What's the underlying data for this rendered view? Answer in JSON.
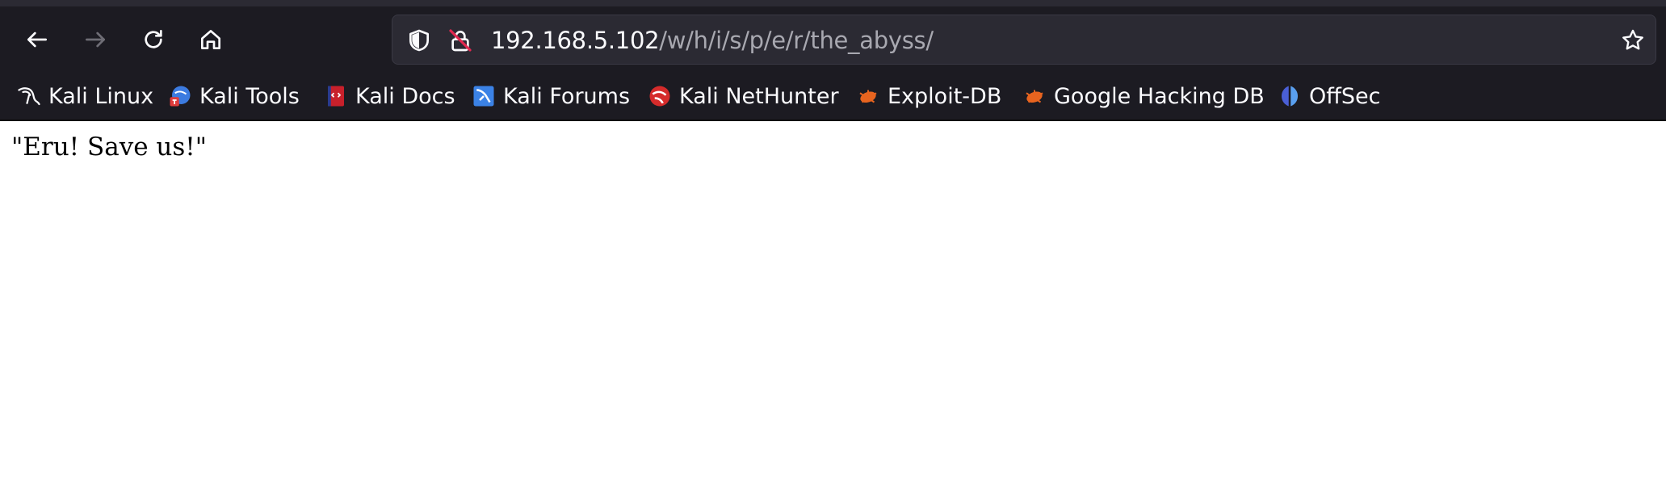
{
  "toolbar": {
    "back_icon": "arrow-left-icon",
    "forward_icon": "arrow-right-icon",
    "reload_icon": "reload-icon",
    "home_icon": "home-icon"
  },
  "urlbar": {
    "host": "192.168.5.102",
    "path": "/w/h/i/s/p/e/r/the_abyss/"
  },
  "bookmarks": [
    {
      "label": "Kali Linux",
      "icon": "kali-dragon-icon"
    },
    {
      "label": "Kali Tools",
      "icon": "kali-tools-icon"
    },
    {
      "label": "Kali Docs",
      "icon": "kali-docs-icon"
    },
    {
      "label": "Kali Forums",
      "icon": "kali-forums-icon"
    },
    {
      "label": "Kali NetHunter",
      "icon": "kali-nethunter-icon"
    },
    {
      "label": "Exploit-DB",
      "icon": "exploit-db-icon"
    },
    {
      "label": "Google Hacking DB",
      "icon": "ghdb-icon"
    },
    {
      "label": "OffSec",
      "icon": "offsec-icon"
    }
  ],
  "page": {
    "text": "\"Eru! Save us!\""
  },
  "colors": {
    "chrome_bg": "#1c1b22",
    "urlbar_bg": "#2b2a33",
    "text_light": "#fbfbfe",
    "text_dim": "#a8a8b0",
    "page_bg": "#ffffff"
  }
}
